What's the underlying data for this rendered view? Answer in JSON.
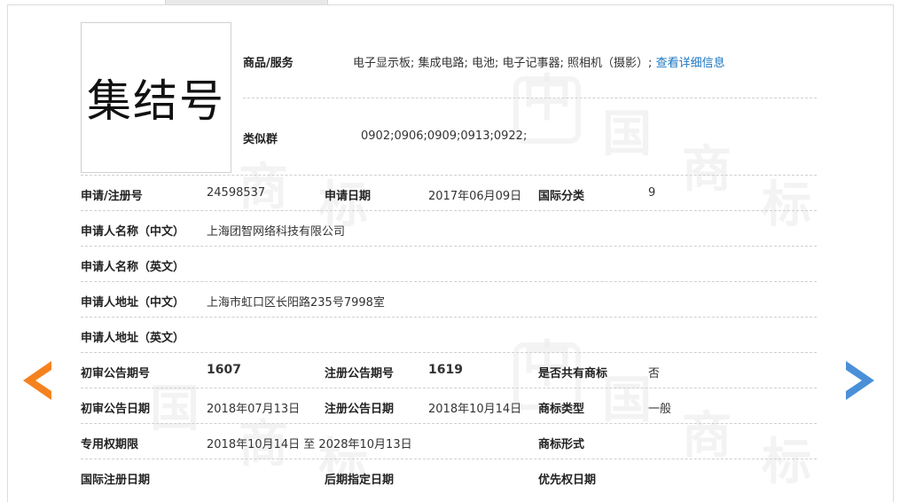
{
  "trademark": {
    "name": "集结号"
  },
  "goods": {
    "label": "商品/服务",
    "value": "电子显示板; 集成电路; 电池; 电子记事器; 照相机（摄影）;",
    "link": "查看详细信息"
  },
  "similar_group": {
    "label": "类似群",
    "value": "0902;0906;0909;0913;0922;"
  },
  "rows": {
    "reg_no_label": "申请/注册号",
    "reg_no": "24598537",
    "apply_date_label": "申请日期",
    "apply_date": "2017年06月09日",
    "intl_class_label": "国际分类",
    "intl_class": "9",
    "applicant_cn_label": "申请人名称（中文）",
    "applicant_cn": "上海团智网络科技有限公司",
    "applicant_en_label": "申请人名称（英文）",
    "address_cn_label": "申请人地址（中文）",
    "address_cn": "上海市虹口区长阳路235号7998室",
    "address_en_label": "申请人地址（英文）",
    "prelim_issue_label": "初审公告期号",
    "prelim_issue": "1607",
    "reg_issue_label": "注册公告期号",
    "reg_issue": "1619",
    "shared_label": "是否共有商标",
    "shared": "否",
    "prelim_date_label": "初审公告日期",
    "prelim_date": "2018年07月13日",
    "reg_date_label": "注册公告日期",
    "reg_date": "2018年10月14日",
    "tm_type_label": "商标类型",
    "tm_type": "一般",
    "exclusive_label": "专用权期限",
    "exclusive": "2018年10月14日 至 2028年10月13日",
    "tm_form_label": "商标形式",
    "intl_reg_date_label": "国际注册日期",
    "later_date_label": "后期指定日期",
    "priority_date_label": "优先权日期"
  },
  "watermark": {
    "chars": [
      "中",
      "国",
      "商",
      "标"
    ]
  },
  "colors": {
    "accent_left": "#f5821f",
    "accent_right": "#4a90d9",
    "link": "#1a76c2"
  }
}
